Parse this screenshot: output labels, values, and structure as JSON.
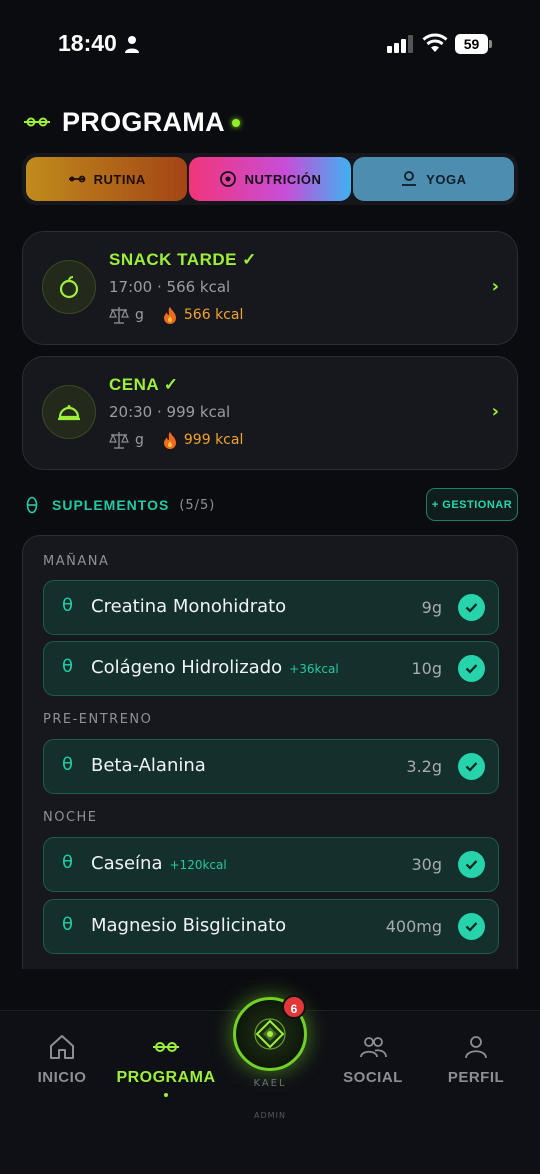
{
  "status_bar": {
    "time": "18:40",
    "battery": "59"
  },
  "header": {
    "title": "PROGRAMA"
  },
  "tabs": [
    {
      "label": "RUTINA",
      "icon": "dumbbell-icon"
    },
    {
      "label": "NUTRICIÓN",
      "icon": "target-icon",
      "active": true
    },
    {
      "label": "YOGA",
      "icon": "yoga-icon"
    }
  ],
  "meals": [
    {
      "name": "SNACK TARDE ✓",
      "meta": "17:00 · 566 kcal",
      "unit": "g",
      "kcal": "566 kcal",
      "icon": "apple-icon"
    },
    {
      "name": "CENA ✓",
      "meta": "20:30 · 999 kcal",
      "unit": "g",
      "kcal": "999 kcal",
      "icon": "cloche-icon"
    }
  ],
  "supplements": {
    "title": "SUPLEMENTOS",
    "count": "(5/5)",
    "manage_label": "+ GESTIONAR",
    "theta": "θ",
    "groups": [
      {
        "label": "MAÑANA",
        "items": [
          {
            "name": "Creatina Monohidrato",
            "extra": "",
            "dose": "9g",
            "checked": true
          },
          {
            "name": "Colágeno Hidrolizado",
            "extra": "+36kcal",
            "dose": "10g",
            "checked": true
          }
        ]
      },
      {
        "label": "PRE-ENTRENO",
        "items": [
          {
            "name": "Beta-Alanina",
            "extra": "",
            "dose": "3.2g",
            "checked": true
          }
        ]
      },
      {
        "label": "NOCHE",
        "items": [
          {
            "name": "Caseína",
            "extra": "+120kcal",
            "dose": "30g",
            "checked": true
          },
          {
            "name": "Magnesio Bisglicinato",
            "extra": "",
            "dose": "400mg",
            "checked": true
          }
        ]
      }
    ]
  },
  "nav": {
    "items": [
      {
        "label": "INICIO",
        "icon": "home-icon"
      },
      {
        "label": "PROGRAMA",
        "icon": "dumbbell-icon",
        "active": true
      },
      {
        "label": "SOCIAL",
        "icon": "people-icon"
      },
      {
        "label": "PERFIL",
        "icon": "person-icon"
      }
    ],
    "center": {
      "name": "KAEL",
      "role": "ADMIN",
      "badge": "6"
    }
  },
  "colors": {
    "accent": "#9cf03a",
    "teal": "#27d3ab",
    "background": "#0b0c10"
  }
}
